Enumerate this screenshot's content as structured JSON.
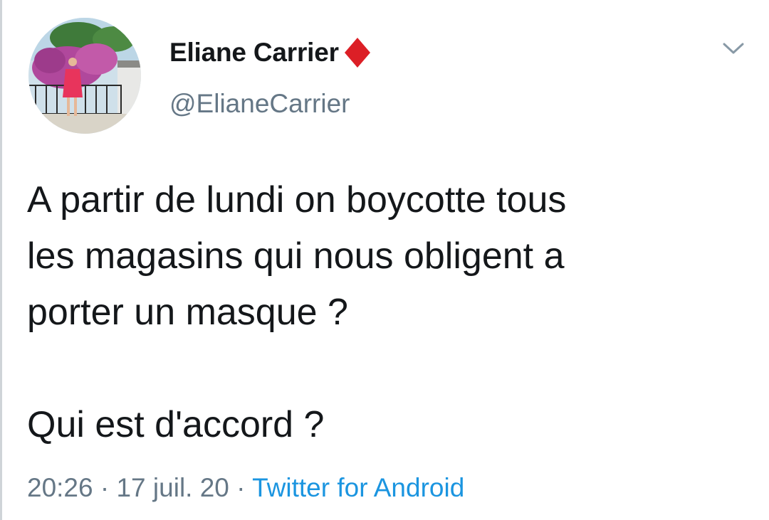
{
  "author": {
    "display_name": "Eliane Carrier",
    "handle": "@ElianeCarrier",
    "name_badge_icon": "red-diamond-icon",
    "badge_color": "#dc1f26"
  },
  "menu": {
    "caret_icon": "chevron-down-icon"
  },
  "tweet": {
    "lines": [
      "A partir de lundi on boycotte tous",
      "les magasins qui nous obligent a",
      "porter un masque ?",
      "",
      "Qui est d'accord ?"
    ]
  },
  "meta": {
    "time": "20:26",
    "separator": " · ",
    "date": "17 juil. 20",
    "source": "Twitter for Android"
  },
  "colors": {
    "text_primary": "#14171a",
    "text_secondary": "#657786",
    "link": "#1b95e0"
  }
}
